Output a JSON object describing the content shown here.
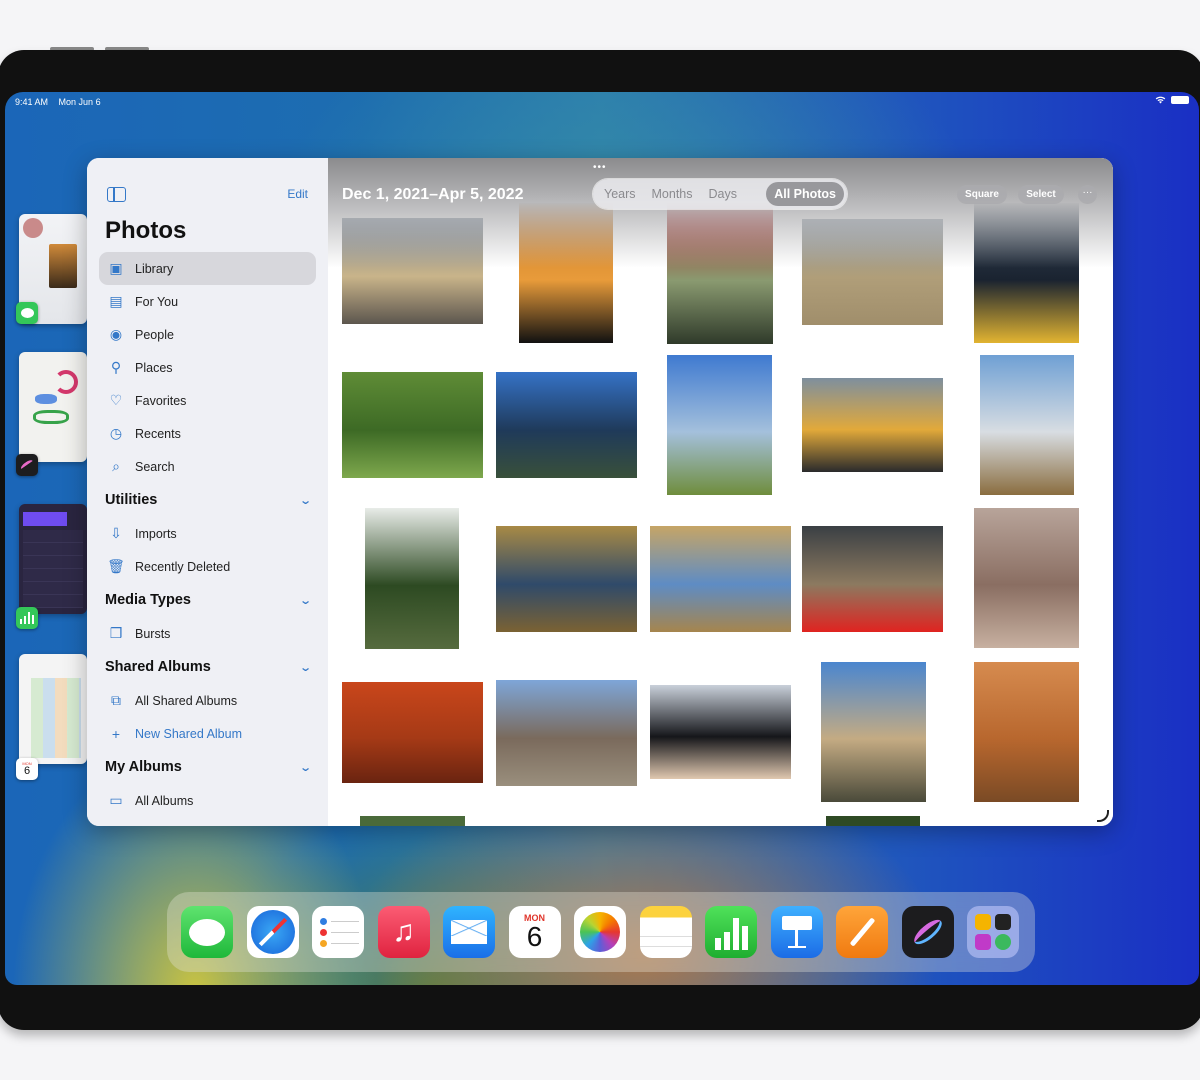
{
  "status_bar": {
    "time": "9:41 AM",
    "date": "Mon Jun 6",
    "wifi_icon": "wifi-icon",
    "battery_icon": "battery-icon"
  },
  "slide_over_apps": [
    {
      "app": "Messages",
      "icon": "messages-icon"
    },
    {
      "app": "Procreate",
      "icon": "procreate-icon"
    },
    {
      "app": "Numbers",
      "icon": "numbers-icon"
    },
    {
      "app": "Calendar",
      "icon": "calendar-icon",
      "day_label": "MON",
      "day_number": "6"
    }
  ],
  "sidebar": {
    "toggle_icon": "sidebar-toggle-icon",
    "edit_label": "Edit",
    "title": "Photos",
    "items": [
      {
        "label": "Library",
        "icon": "library-icon",
        "active": true
      },
      {
        "label": "For You",
        "icon": "for-you-icon"
      },
      {
        "label": "People",
        "icon": "people-icon"
      },
      {
        "label": "Places",
        "icon": "places-icon"
      },
      {
        "label": "Favorites",
        "icon": "heart-icon"
      },
      {
        "label": "Recents",
        "icon": "clock-icon"
      },
      {
        "label": "Search",
        "icon": "search-icon"
      }
    ],
    "sections": [
      {
        "title": "Utilities",
        "items": [
          {
            "label": "Imports",
            "icon": "import-icon"
          },
          {
            "label": "Recently Deleted",
            "icon": "trash-icon"
          }
        ]
      },
      {
        "title": "Media Types",
        "items": [
          {
            "label": "Bursts",
            "icon": "bursts-icon"
          }
        ]
      },
      {
        "title": "Shared Albums",
        "items": [
          {
            "label": "All Shared Albums",
            "icon": "shared-albums-icon"
          },
          {
            "label": "New Shared Album",
            "icon": "plus-icon"
          }
        ]
      },
      {
        "title": "My Albums",
        "items": [
          {
            "label": "All Albums",
            "icon": "albums-icon"
          }
        ]
      }
    ]
  },
  "content": {
    "date_range": "Dec 1, 2021–Apr 5, 2022",
    "grab_handle": "•••",
    "view_tabs": [
      "Years",
      "Months",
      "Days",
      "All Photos"
    ],
    "selected_tab": "All Photos",
    "square_label": "Square",
    "select_label": "Select",
    "more_label": "···",
    "photos": [
      {
        "subject": "mountain ridge sunset with grass",
        "colors": [
          "#6f7e8f",
          "#c9b48a",
          "#5c564e"
        ]
      },
      {
        "subject": "hiker silhouette at orange sunset",
        "colors": [
          "#c77b2a",
          "#e89b3a",
          "#111"
        ]
      },
      {
        "subject": "view from red tent onto mountains",
        "colors": [
          "#b01d22",
          "#8a9a70",
          "#2f3a2a"
        ]
      },
      {
        "subject": "sand dune with two people",
        "colors": [
          "#8e9aa6",
          "#b09e79",
          "#a08e6b"
        ]
      },
      {
        "subject": "yellow paddle in dark water",
        "colors": [
          "#3a4a5c",
          "#1a2330",
          "#e2b431"
        ]
      },
      {
        "subject": "green leaf with water droplets",
        "colors": [
          "#5f8c36",
          "#3d6a25",
          "#7ea84d"
        ]
      },
      {
        "subject": "lake with kayakers and trees",
        "colors": [
          "#3572c6",
          "#1f3a5a",
          "#39503a"
        ]
      },
      {
        "subject": "river through green meadow",
        "colors": [
          "#3f7ad0",
          "#a4c0dc",
          "#6f8d3c"
        ]
      },
      {
        "subject": "cyclist in yellow jacket close-up",
        "colors": [
          "#7e8f9e",
          "#e2a93a",
          "#2a2a2c"
        ]
      },
      {
        "subject": "two mountain bikers on grassland",
        "colors": [
          "#6fa0d4",
          "#d8dde2",
          "#8a6d3f"
        ]
      },
      {
        "subject": "forest road with tall trees",
        "colors": [
          "#e8ece8",
          "#2d4a22",
          "#566b3e"
        ]
      },
      {
        "subject": "wetland with blue pools",
        "colors": [
          "#a88a45",
          "#2f4a6a",
          "#7b6233"
        ]
      },
      {
        "subject": "sandstone arch with sky",
        "colors": [
          "#c6a566",
          "#5e8cc4",
          "#a6854d"
        ]
      },
      {
        "subject": "person with red tent at rocks night",
        "colors": [
          "#3a3f44",
          "#8c7a60",
          "#e02320"
        ]
      },
      {
        "subject": "desert rock formations at dusk",
        "colors": [
          "#b8a49a",
          "#8a6e62",
          "#c7b0a0"
        ]
      },
      {
        "subject": "bicycle shadow on red ground",
        "colors": [
          "#c9461b",
          "#a63a16",
          "#6a2410"
        ]
      },
      {
        "subject": "desert mountains at sunrise",
        "colors": [
          "#7ea6d8",
          "#7a6a5c",
          "#9a8f7d"
        ]
      },
      {
        "subject": "cyclist silhouette at dusk",
        "colors": [
          "#c9d0da",
          "#15161a",
          "#e0c8b0"
        ]
      },
      {
        "subject": "winding road through foggy hills",
        "colors": [
          "#4a86cf",
          "#c4ab83",
          "#4a4a3a"
        ]
      },
      {
        "subject": "sand ripples orange desert",
        "colors": [
          "#d68b4f",
          "#b8672e",
          "#7a4a25"
        ]
      }
    ]
  },
  "dock": {
    "apps": [
      {
        "name": "Messages",
        "icon": "messages-icon"
      },
      {
        "name": "Safari",
        "icon": "safari-icon"
      },
      {
        "name": "Reminders",
        "icon": "reminders-icon"
      },
      {
        "name": "Music",
        "icon": "music-icon"
      },
      {
        "name": "Mail",
        "icon": "mail-icon"
      },
      {
        "name": "Calendar",
        "icon": "calendar-icon",
        "day_label": "MON",
        "day_number": "6"
      },
      {
        "name": "Photos",
        "icon": "photos-icon"
      },
      {
        "name": "Notes",
        "icon": "notes-icon"
      },
      {
        "name": "Numbers",
        "icon": "numbers-icon"
      },
      {
        "name": "Keynote",
        "icon": "keynote-icon"
      },
      {
        "name": "Pages",
        "icon": "pages-icon"
      },
      {
        "name": "Procreate",
        "icon": "procreate-icon"
      },
      {
        "name": "App Folder",
        "icon": "app-folder-icon"
      }
    ]
  }
}
